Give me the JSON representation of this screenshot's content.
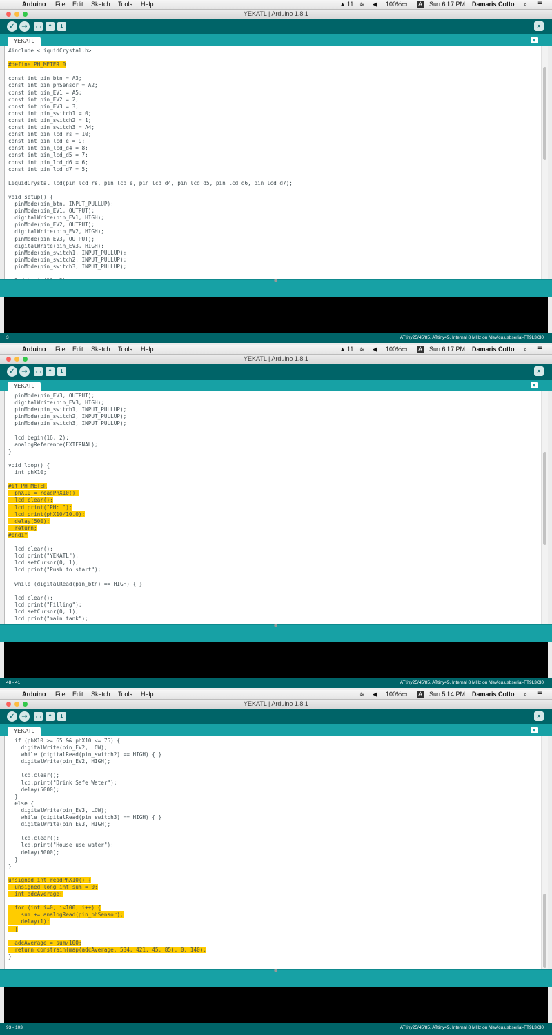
{
  "menubar": {
    "apple": "",
    "app": "Arduino",
    "items": [
      "File",
      "Edit",
      "Sketch",
      "Tools",
      "Help"
    ],
    "status_badge": "11",
    "battery": "100%",
    "input_badge": "A",
    "user": "Damaris Cotto"
  },
  "panels": [
    {
      "clock": "Sun 6:17 PM",
      "line_status": "3"
    },
    {
      "clock": "Sun 6:17 PM",
      "line_status": "48 - 41"
    },
    {
      "clock": "Sun 5:14 PM",
      "line_status": "93 - 103"
    }
  ],
  "window": {
    "title": "YEKATL | Arduino 1.8.1",
    "tab": "YEKATL"
  },
  "board_status": "ATtiny25/45/85, ATtiny45, Internal 8 MHz on /dev/cu.usbserial-FT9L3CI0",
  "toolbar": {
    "verify": "✓",
    "upload": "→",
    "new": "▭",
    "open": "↑",
    "save": "↓",
    "serial": "⌕"
  },
  "code1": [
    "#include <LiquidCrystal.h>",
    "",
    "#define PH_METER 0",
    "",
    "const int pin_btn = A3;",
    "const int pin_phSensor = A2;",
    "const int pin_EV1 = A5;",
    "const int pin_EV2 = 2;",
    "const int pin_EV3 = 3;",
    "const int pin_switch1 = 0;",
    "const int pin_switch2 = 1;",
    "const int pin_switch3 = A4;",
    "const int pin_lcd_rs = 10;",
    "const int pin_lcd_e = 9;",
    "const int pin_lcd_d4 = 8;",
    "const int pin_lcd_d5 = 7;",
    "const int pin_lcd_d6 = 6;",
    "const int pin_lcd_d7 = 5;",
    "",
    "LiquidCrystal lcd(pin_lcd_rs, pin_lcd_e, pin_lcd_d4, pin_lcd_d5, pin_lcd_d6, pin_lcd_d7);",
    "",
    "void setup() {",
    "  pinMode(pin_btn, INPUT_PULLUP);",
    "  pinMode(pin_EV1, OUTPUT);",
    "  digitalWrite(pin_EV1, HIGH);",
    "  pinMode(pin_EV2, OUTPUT);",
    "  digitalWrite(pin_EV2, HIGH);",
    "  pinMode(pin_EV3, OUTPUT);",
    "  digitalWrite(pin_EV3, HIGH);",
    "  pinMode(pin_switch1, INPUT_PULLUP);",
    "  pinMode(pin_switch2, INPUT_PULLUP);",
    "  pinMode(pin_switch3, INPUT_PULLUP);",
    "",
    "  lcd.begin(16, 2);"
  ],
  "code2": [
    "  pinMode(pin_EV3, OUTPUT);",
    "  digitalWrite(pin_EV3, HIGH);",
    "  pinMode(pin_switch1, INPUT_PULLUP);",
    "  pinMode(pin_switch2, INPUT_PULLUP);",
    "  pinMode(pin_switch3, INPUT_PULLUP);",
    "",
    "  lcd.begin(16, 2);",
    "  analogReference(EXTERNAL);",
    "}",
    "",
    "void loop() {",
    "  int phX10;",
    "",
    "#if PH_METER",
    "  phX10 = readPhX10();",
    "  lcd.clear();",
    "  lcd.print(\"PH: \");",
    "  lcd.print(phX10/10.0);",
    "  delay(500);",
    "  return;",
    "#endif",
    "",
    "  lcd.clear();",
    "  lcd.print(\"YEKATL\");",
    "  lcd.setCursor(0, 1);",
    "  lcd.print(\"Push to start\");",
    "",
    "  while (digitalRead(pin_btn) == HIGH) { }",
    "",
    "  lcd.clear();",
    "  lcd.print(\"Filling\");",
    "  lcd.setCursor(0, 1);",
    "  lcd.print(\"main tank\");"
  ],
  "code3": [
    "  if (phX10 >= 65 && phX10 <= 75) {",
    "    digitalWrite(pin_EV2, LOW);",
    "    while (digitalRead(pin_switch2) == HIGH) { }",
    "    digitalWrite(pin_EV2, HIGH);",
    "",
    "    lcd.clear();",
    "    lcd.print(\"Drink Safe Water\");",
    "    delay(5000);",
    "  }",
    "  else {",
    "    digitalWrite(pin_EV3, LOW);",
    "    while (digitalRead(pin_switch3) == HIGH) { }",
    "    digitalWrite(pin_EV3, HIGH);",
    "",
    "    lcd.clear();",
    "    lcd.print(\"House use water\");",
    "    delay(5000);",
    "  }",
    "}",
    "",
    "unsigned int readPhX10() {",
    "  unsigned long int sum = 0;",
    "  int adcAverage;",
    "",
    "  for (int i=0; i<100; i++) {",
    "    sum += analogRead(pin_phSensor);",
    "    delay(1);",
    "  }",
    "",
    "  adcAverage = sum/100;",
    "  return constrain(map(adcAverage, 534, 421, 45, 85), 0, 140);",
    "}"
  ],
  "highlights": {
    "code1": [
      2
    ],
    "code2": [
      13,
      14,
      15,
      16,
      17,
      18,
      19,
      20
    ],
    "code3": [
      20,
      21,
      22,
      24,
      25,
      26,
      27,
      29,
      30
    ]
  }
}
